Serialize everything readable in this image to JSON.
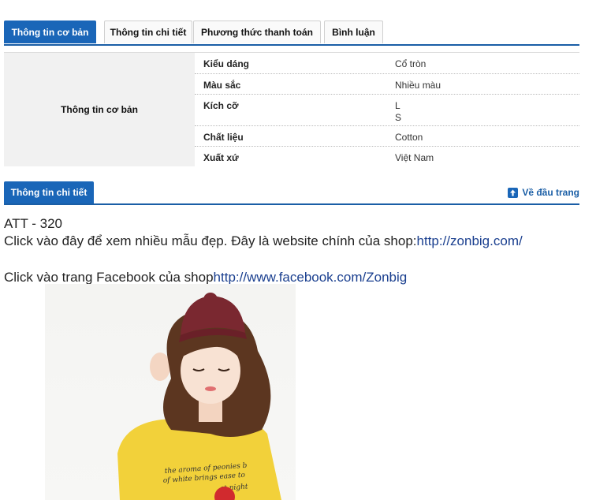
{
  "tabs": [
    {
      "label": "Thông tin cơ bản",
      "active": true
    },
    {
      "label": "Thông tin chi tiết",
      "active": false
    },
    {
      "label": "Phương thức thanh toán",
      "active": false
    },
    {
      "label": "Bình luận",
      "active": false
    }
  ],
  "basic_info": {
    "heading": "Thông tin cơ bản",
    "rows": [
      {
        "key": "Kiểu dáng",
        "value": "Cổ tròn"
      },
      {
        "key": "Màu sắc",
        "value": "Nhiều màu"
      },
      {
        "key": "Kích cỡ",
        "value": "L",
        "value2": "S"
      },
      {
        "key": "Chất liệu",
        "value": "Cotton"
      },
      {
        "key": "Xuất xứ",
        "value": "Việt Nam"
      }
    ]
  },
  "details_section": {
    "tab_label": "Thông tin chi tiết",
    "back_to_top": "Về đầu trang"
  },
  "description": {
    "code": "ATT - 320",
    "line2_text": "Click vào đây để xem nhiều mẫu đẹp. Đây là website chính của shop:",
    "line2_link": "http://zonbig.com/",
    "line3_text": "Click vào trang Facebook của shop",
    "line3_link": "http://www.facebook.com/Zonbig"
  },
  "photo": {
    "shirt_text_line1": "the aroma of peonies b",
    "shirt_text_line2": "of white brings ease to",
    "shirt_text_line3": "at night",
    "colors": {
      "hat": "#7a2830",
      "hair": "#5a3520",
      "shirt": "#f2d13a",
      "skin": "#f6dccb"
    }
  },
  "colors": {
    "accent": "#1a66b8",
    "link": "#1a3f8f"
  }
}
